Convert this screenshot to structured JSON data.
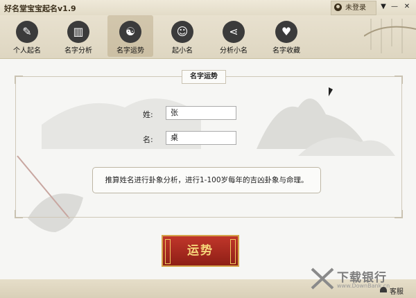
{
  "window": {
    "title": "好名堂宝宝起名v1.9",
    "login_label": "未登录",
    "controls": [
      "▼",
      "—",
      "✕"
    ]
  },
  "toolbar": {
    "items": [
      {
        "label": "个人起名",
        "icon": "pen-icon",
        "glyph": "✎"
      },
      {
        "label": "名字分析",
        "icon": "bar-chart-icon",
        "glyph": "▥"
      },
      {
        "label": "名字运势",
        "icon": "yin-yang-icon",
        "glyph": "☯"
      },
      {
        "label": "起小名",
        "icon": "baby-icon",
        "glyph": "☺"
      },
      {
        "label": "分析小名",
        "icon": "share-icon",
        "glyph": "⋖"
      },
      {
        "label": "名字收藏",
        "icon": "heart-icon",
        "glyph": "♥"
      }
    ],
    "active_index": 2
  },
  "panel": {
    "tab_label": "名字运势",
    "surname_label": "姓:",
    "surname_value": "张",
    "given_label": "名:",
    "given_value": "桌",
    "description": "推算姓名进行卦象分析，进行1-100岁每年的吉凶卦象与命理。"
  },
  "action": {
    "button_label": "运势"
  },
  "footer": {
    "watermark_text": "下载银行",
    "watermark_sub": "www.DownBank.cn",
    "service_label": "客服"
  },
  "colors": {
    "titlebar": "#e8e1cf",
    "button_red": "#b3291e",
    "button_gold": "#f6d67a"
  }
}
